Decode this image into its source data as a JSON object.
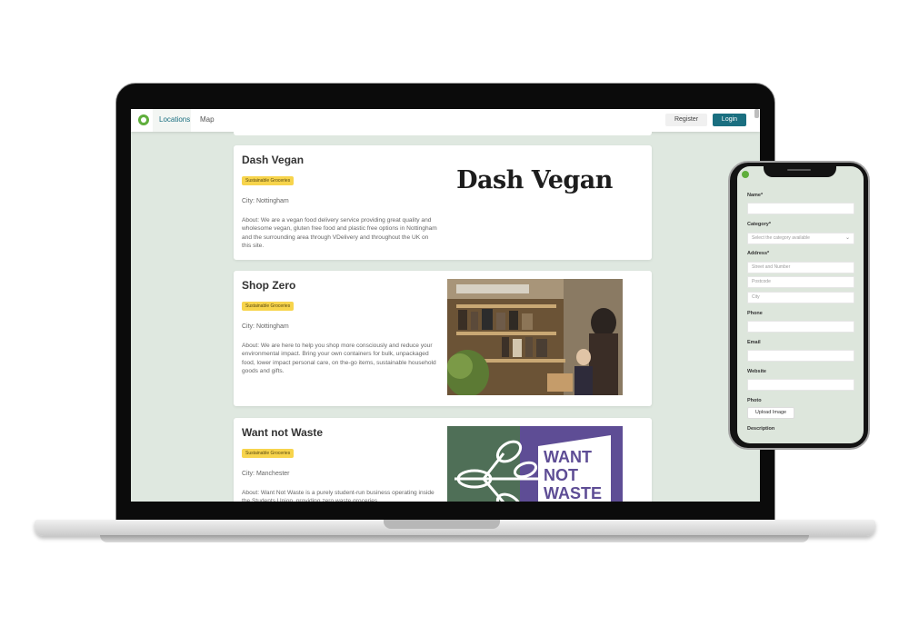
{
  "navbar": {
    "links": [
      "Locations",
      "Map"
    ],
    "register_label": "Register",
    "login_label": "Login"
  },
  "cards": [
    {
      "title": "Dash Vegan",
      "badge": "Sustainable Groceries",
      "city": "City: Nottingham",
      "about": "About: We are a vegan food delivery service providing great quality and wholesome vegan, gluten free food and plastic free options in Nottingham and the surrounding area through VDelivery and throughout the UK on this site.",
      "logo_text": "Dash Vegan"
    },
    {
      "title": "Shop Zero",
      "badge": "Sustainable Groceries",
      "city": "City: Nottingham",
      "about": "About: We are here to help you shop more consciously and reduce your environmental impact. Bring your own containers for bulk, unpackaged food, lower impact personal care, on the-go items, sustainable household goods and gifts."
    },
    {
      "title": "Want not Waste",
      "badge": "Sustainable Groceries",
      "city": "City: Manchester",
      "about": "About: Want Not Waste is a purely student-run business operating inside the Students Union, providing zero waste groceries.",
      "logo_lines": [
        "WANT",
        "NOT",
        "WASTE"
      ]
    }
  ],
  "phone_form": {
    "name_label": "Name*",
    "category_label": "Category*",
    "category_placeholder": "Select the category available",
    "address_label": "Address*",
    "street_placeholder": "Street and Number",
    "postcode_placeholder": "Postcode",
    "city_placeholder": "City",
    "phone_label": "Phone",
    "email_label": "Email",
    "website_label": "Website",
    "photo_label": "Photo",
    "upload_label": "Upload Image",
    "description_label": "Description"
  },
  "colors": {
    "accent": "#1a6f80",
    "badge": "#f7d44c",
    "page_bg": "#dfe8e0",
    "brand_green": "#5fae3c",
    "wnw_green": "#4f6f57",
    "wnw_purple": "#5e4d95"
  }
}
